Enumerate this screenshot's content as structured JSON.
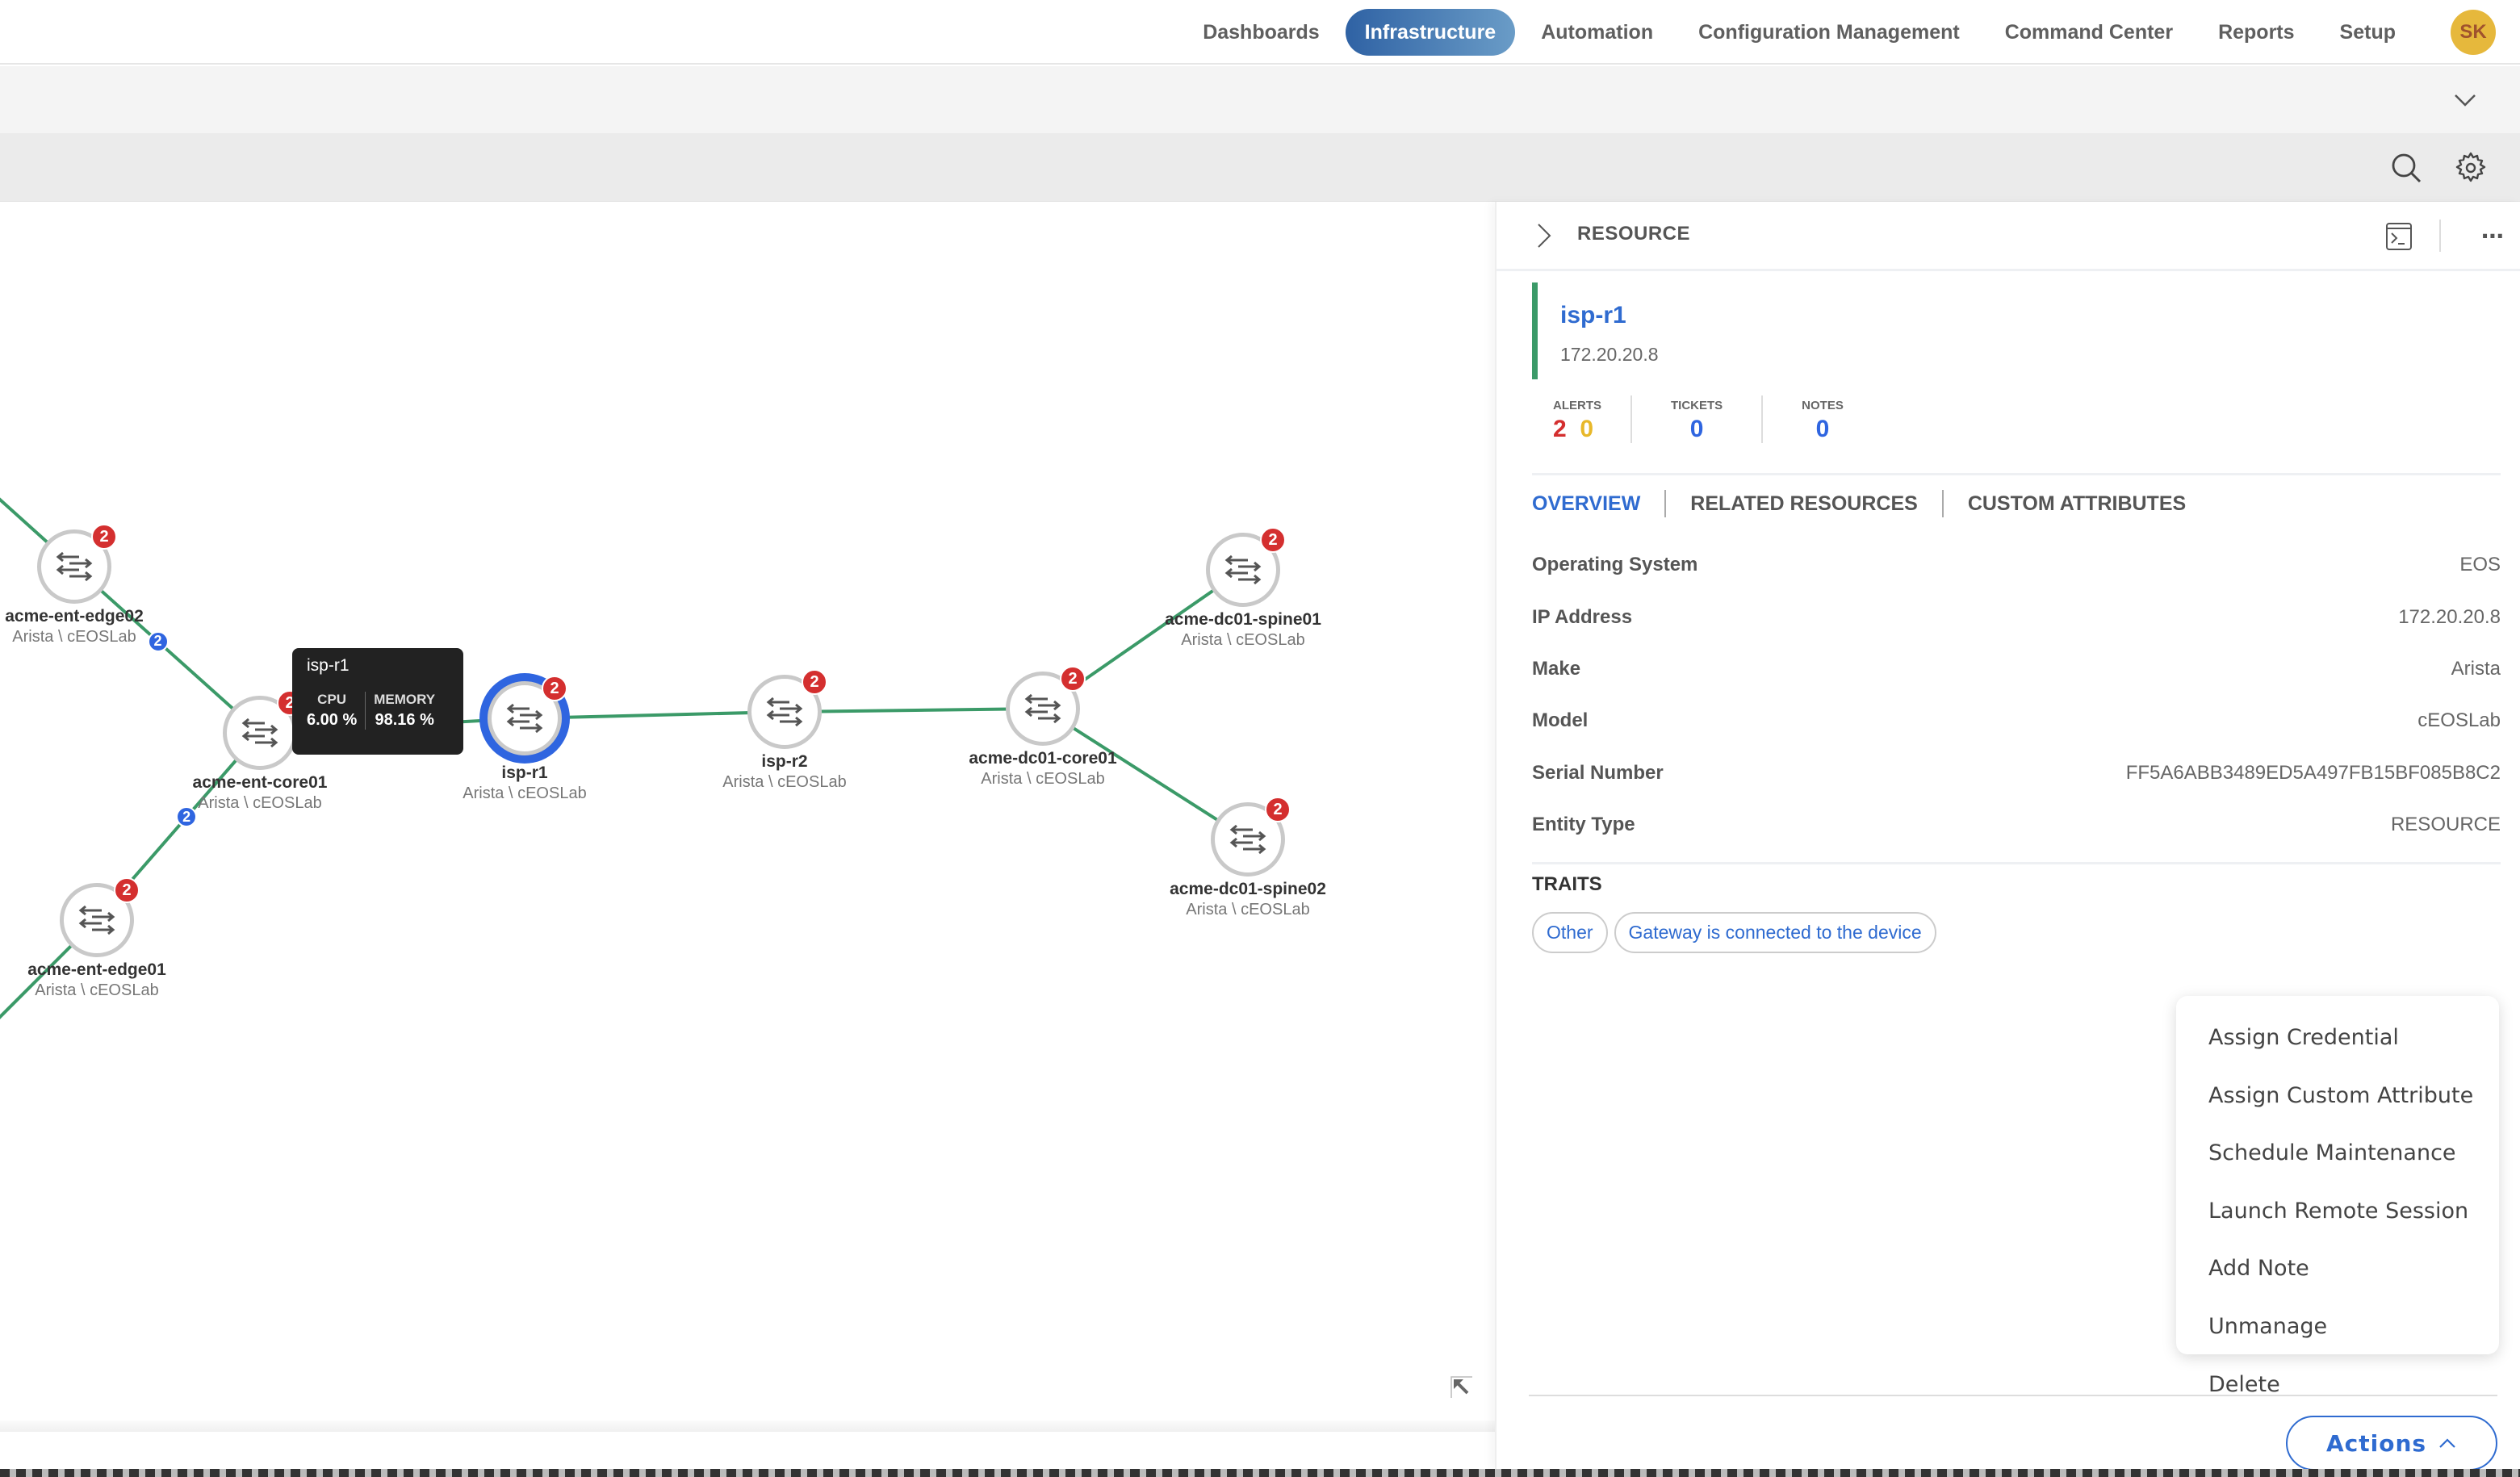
{
  "nav": {
    "items": [
      {
        "label": "Dashboards",
        "active": false
      },
      {
        "label": "Infrastructure",
        "active": true
      },
      {
        "label": "Automation",
        "active": false
      },
      {
        "label": "Configuration Management",
        "active": false
      },
      {
        "label": "Command Center",
        "active": false
      },
      {
        "label": "Reports",
        "active": false
      },
      {
        "label": "Setup",
        "active": false
      }
    ],
    "avatar_initials": "SK"
  },
  "toolbar": {
    "expand_icon": "chevron-down-icon",
    "search_icon": "search-icon",
    "settings_icon": "gear-icon"
  },
  "topology": {
    "nodes": [
      {
        "id": "acme-ent-edge02",
        "name": "acme-ent-edge02",
        "sub": "Arista \\ cEOSLab",
        "alerts": "2",
        "selected": false
      },
      {
        "id": "acme-ent-core01",
        "name": "acme-ent-core01",
        "sub": "Arista \\ cEOSLab",
        "alerts": "2",
        "selected": false
      },
      {
        "id": "acme-ent-edge01",
        "name": "acme-ent-edge01",
        "sub": "Arista \\ cEOSLab",
        "alerts": "2",
        "selected": false
      },
      {
        "id": "isp-r1",
        "name": "isp-r1",
        "sub": "Arista \\ cEOSLab",
        "alerts": "2",
        "selected": true
      },
      {
        "id": "isp-r2",
        "name": "isp-r2",
        "sub": "Arista \\ cEOSLab",
        "alerts": "2",
        "selected": false
      },
      {
        "id": "acme-dc01-core01",
        "name": "acme-dc01-core01",
        "sub": "Arista \\ cEOSLab",
        "alerts": "2",
        "selected": false
      },
      {
        "id": "acme-dc01-spine01",
        "name": "acme-dc01-spine01",
        "sub": "Arista \\ cEOSLab",
        "alerts": "2",
        "selected": false
      },
      {
        "id": "acme-dc01-spine02",
        "name": "acme-dc01-spine02",
        "sub": "Arista \\ cEOSLab",
        "alerts": "2",
        "selected": false
      }
    ],
    "link_badges": [
      {
        "between": [
          "acme-ent-edge02",
          "acme-ent-core01"
        ],
        "count": "2"
      },
      {
        "between": [
          "acme-ent-core01",
          "acme-ent-edge01"
        ],
        "count": "2"
      }
    ],
    "tooltip": {
      "title": "isp-r1",
      "cpu_label": "CPU",
      "cpu_value": "6.00 %",
      "memory_label": "MEMORY",
      "memory_value": "98.16 %"
    },
    "link_color": "#3b9a68"
  },
  "panel": {
    "title": "RESOURCE",
    "resource_name": "isp-r1",
    "resource_ip": "172.20.20.8",
    "stats": {
      "alerts_label": "ALERTS",
      "alerts_critical": "2",
      "alerts_warning": "0",
      "tickets_label": "TICKETS",
      "tickets": "0",
      "notes_label": "NOTES",
      "notes": "0"
    },
    "tabs": [
      {
        "label": "OVERVIEW",
        "active": true
      },
      {
        "label": "RELATED RESOURCES",
        "active": false
      },
      {
        "label": "CUSTOM ATTRIBUTES",
        "active": false
      }
    ],
    "properties": [
      {
        "key": "Operating System",
        "value": "EOS"
      },
      {
        "key": "IP Address",
        "value": "172.20.20.8"
      },
      {
        "key": "Make",
        "value": "Arista"
      },
      {
        "key": "Model",
        "value": "cEOSLab"
      },
      {
        "key": "Serial Number",
        "value": "FF5A6ABB3489ED5A497FB15BF085B8C2"
      },
      {
        "key": "Entity Type",
        "value": "RESOURCE"
      }
    ],
    "traits_title": "TRAITS",
    "traits": [
      "Other",
      "Gateway is connected to the device"
    ]
  },
  "actions_menu": {
    "items": [
      "Assign Credential",
      "Assign Custom Attribute",
      "Schedule Maintenance",
      "Launch Remote Session",
      "Add Note",
      "Unmanage",
      "Delete"
    ],
    "button_label": "Actions"
  },
  "colors": {
    "accent": "#2f6bd0",
    "alert_red": "#d42f2f",
    "warning_yellow": "#e8b82a",
    "link_green": "#3b9a68",
    "avatar": "#e6b83c"
  }
}
